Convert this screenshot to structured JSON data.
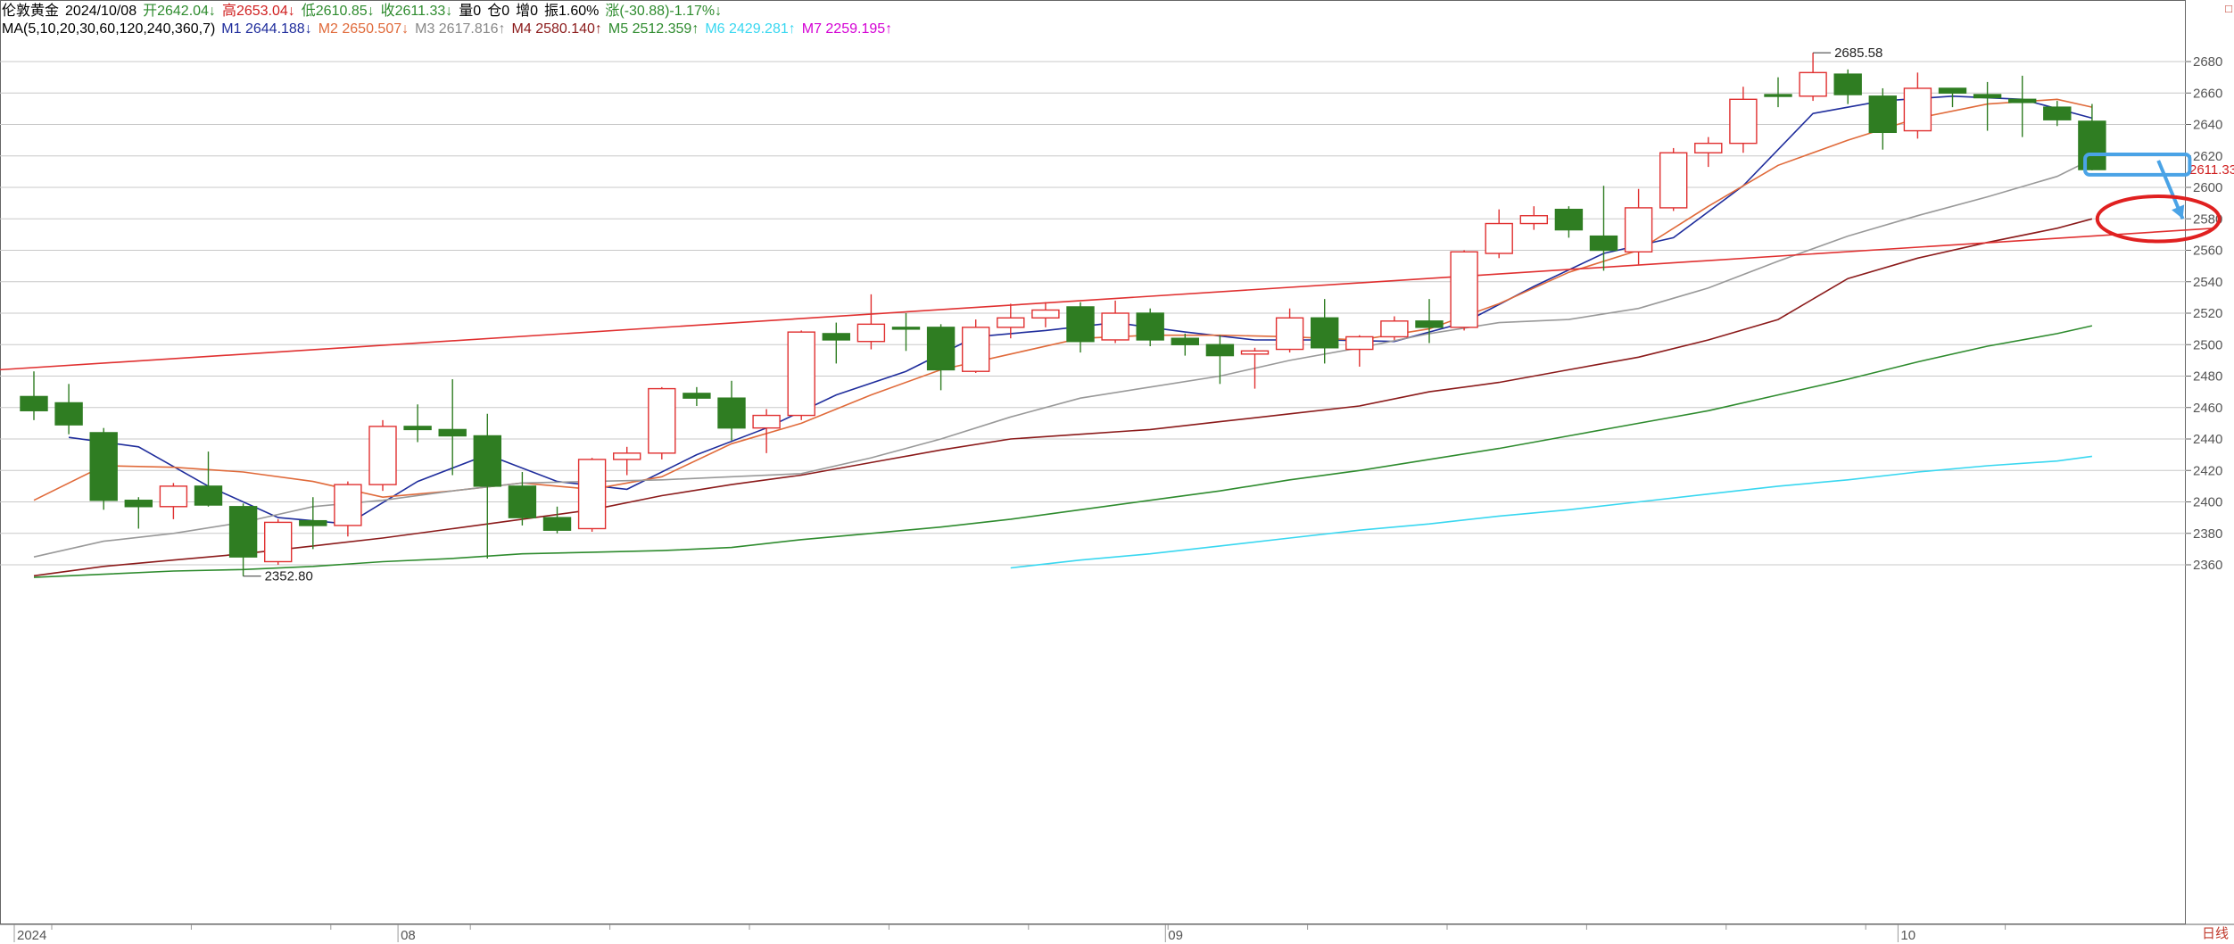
{
  "header": {
    "instrument": "伦敦黄金",
    "date": "2024/10/08",
    "open": "开2642.04↓",
    "high": "高2653.04↓",
    "low": "低2610.85↓",
    "close": "收2611.33↓",
    "volume": "量0",
    "position": "仓0",
    "increase": "增0",
    "amplitude": "振1.60%",
    "change": "涨(-30.88)-1.17%↓"
  },
  "ma_header": {
    "params": "MA(5,10,20,30,60,120,240,360,7)",
    "items": [
      {
        "text": "M1 2644.188↓",
        "color": "#1f2d9c"
      },
      {
        "text": "M2 2650.507↓",
        "color": "#e06a3a"
      },
      {
        "text": "M3 2617.816↑",
        "color": "#888888"
      },
      {
        "text": "M4 2580.140↑",
        "color": "#8b1a1a"
      },
      {
        "text": "M5 2512.359↑",
        "color": "#2e8b2e"
      },
      {
        "text": "M6 2429.281↑",
        "color": "#39d7f0"
      },
      {
        "text": "M7 2259.195↑",
        "color": "#d400d4"
      }
    ]
  },
  "period_label": "日线",
  "corner_mark": "□",
  "chart_data": {
    "type": "candlestick",
    "y_ticks": [
      2360,
      2380,
      2400,
      2420,
      2440,
      2460,
      2480,
      2500,
      2520,
      2540,
      2560,
      2580,
      2600,
      2620,
      2640,
      2660,
      2680
    ],
    "ylim": [
      2350,
      2693
    ],
    "current_price_label": "2611.33",
    "x_labels": [
      {
        "index": 0,
        "text": "2024"
      },
      {
        "index": 11,
        "text": "08"
      },
      {
        "index": 33,
        "text": "09"
      },
      {
        "index": 54,
        "text": "10"
      }
    ],
    "annotations": {
      "max_label": "2685.58",
      "max_index": 51,
      "min_label": "2352.80",
      "min_index": 6
    },
    "candles": [
      {
        "o": 2467,
        "h": 2483,
        "l": 2452,
        "c": 2458
      },
      {
        "o": 2463,
        "h": 2475,
        "l": 2443,
        "c": 2449
      },
      {
        "o": 2444,
        "h": 2447,
        "l": 2395,
        "c": 2401
      },
      {
        "o": 2401,
        "h": 2403,
        "l": 2383,
        "c": 2397
      },
      {
        "o": 2397,
        "h": 2412,
        "l": 2389,
        "c": 2410
      },
      {
        "o": 2410,
        "h": 2432,
        "l": 2397,
        "c": 2398
      },
      {
        "o": 2397,
        "h": 2399,
        "l": 2352.8,
        "c": 2365
      },
      {
        "o": 2362,
        "h": 2389,
        "l": 2360,
        "c": 2387
      },
      {
        "o": 2388,
        "h": 2403,
        "l": 2370,
        "c": 2385
      },
      {
        "o": 2385,
        "h": 2413,
        "l": 2378,
        "c": 2411
      },
      {
        "o": 2411,
        "h": 2452,
        "l": 2407,
        "c": 2448
      },
      {
        "o": 2448,
        "h": 2462,
        "l": 2438,
        "c": 2446
      },
      {
        "o": 2446,
        "h": 2478,
        "l": 2417,
        "c": 2442
      },
      {
        "o": 2442,
        "h": 2456,
        "l": 2364,
        "c": 2410
      },
      {
        "o": 2410,
        "h": 2419,
        "l": 2385,
        "c": 2390
      },
      {
        "o": 2390,
        "h": 2397,
        "l": 2380,
        "c": 2382
      },
      {
        "o": 2383,
        "h": 2428,
        "l": 2381,
        "c": 2427
      },
      {
        "o": 2427,
        "h": 2435,
        "l": 2417,
        "c": 2431
      },
      {
        "o": 2431,
        "h": 2473,
        "l": 2427,
        "c": 2472
      },
      {
        "o": 2469,
        "h": 2473,
        "l": 2461,
        "c": 2466
      },
      {
        "o": 2466,
        "h": 2477,
        "l": 2439,
        "c": 2447
      },
      {
        "o": 2447,
        "h": 2459,
        "l": 2431,
        "c": 2455
      },
      {
        "o": 2455,
        "h": 2509,
        "l": 2452,
        "c": 2508
      },
      {
        "o": 2507,
        "h": 2514,
        "l": 2488,
        "c": 2503
      },
      {
        "o": 2502,
        "h": 2532,
        "l": 2497,
        "c": 2513
      },
      {
        "o": 2511,
        "h": 2520,
        "l": 2496,
        "c": 2510
      },
      {
        "o": 2511,
        "h": 2513,
        "l": 2471,
        "c": 2484
      },
      {
        "o": 2483,
        "h": 2516,
        "l": 2482,
        "c": 2511
      },
      {
        "o": 2511,
        "h": 2526,
        "l": 2504,
        "c": 2517
      },
      {
        "o": 2517,
        "h": 2527,
        "l": 2511,
        "c": 2522
      },
      {
        "o": 2524,
        "h": 2527,
        "l": 2495,
        "c": 2502
      },
      {
        "o": 2503,
        "h": 2528,
        "l": 2501,
        "c": 2520
      },
      {
        "o": 2520,
        "h": 2523,
        "l": 2499,
        "c": 2503
      },
      {
        "o": 2504,
        "h": 2507,
        "l": 2493,
        "c": 2500
      },
      {
        "o": 2500,
        "h": 2506,
        "l": 2475,
        "c": 2493
      },
      {
        "o": 2494,
        "h": 2498,
        "l": 2472,
        "c": 2496
      },
      {
        "o": 2497,
        "h": 2523,
        "l": 2495,
        "c": 2517
      },
      {
        "o": 2517,
        "h": 2529,
        "l": 2488,
        "c": 2498
      },
      {
        "o": 2497,
        "h": 2506,
        "l": 2486,
        "c": 2505
      },
      {
        "o": 2505,
        "h": 2518,
        "l": 2503,
        "c": 2515
      },
      {
        "o": 2515,
        "h": 2529,
        "l": 2501,
        "c": 2511
      },
      {
        "o": 2511,
        "h": 2560,
        "l": 2509,
        "c": 2559
      },
      {
        "o": 2558,
        "h": 2586,
        "l": 2555,
        "c": 2577
      },
      {
        "o": 2577,
        "h": 2588,
        "l": 2573,
        "c": 2582
      },
      {
        "o": 2586,
        "h": 2588,
        "l": 2568,
        "c": 2573
      },
      {
        "o": 2569,
        "h": 2601,
        "l": 2547,
        "c": 2560
      },
      {
        "o": 2559,
        "h": 2599,
        "l": 2551,
        "c": 2587
      },
      {
        "o": 2587,
        "h": 2625,
        "l": 2585,
        "c": 2622
      },
      {
        "o": 2622,
        "h": 2632,
        "l": 2613,
        "c": 2628
      },
      {
        "o": 2628,
        "h": 2664,
        "l": 2622,
        "c": 2656
      },
      {
        "o": 2659,
        "h": 2670,
        "l": 2651,
        "c": 2658
      },
      {
        "o": 2658,
        "h": 2685.58,
        "l": 2655,
        "c": 2673
      },
      {
        "o": 2672,
        "h": 2675,
        "l": 2653,
        "c": 2659
      },
      {
        "o": 2658,
        "h": 2663,
        "l": 2624,
        "c": 2635
      },
      {
        "o": 2636,
        "h": 2673,
        "l": 2631,
        "c": 2663
      },
      {
        "o": 2663,
        "h": 2663,
        "l": 2651,
        "c": 2660
      },
      {
        "o": 2659,
        "h": 2667,
        "l": 2636,
        "c": 2657
      },
      {
        "o": 2656,
        "h": 2671,
        "l": 2632,
        "c": 2654
      },
      {
        "o": 2651,
        "h": 2655,
        "l": 2639,
        "c": 2643
      },
      {
        "o": 2642.04,
        "h": 2653.04,
        "l": 2610.85,
        "c": 2611.33
      }
    ],
    "ma_lines": [
      {
        "name": "M1",
        "color": "#1f2d9c",
        "values": [
          [
            1,
            2441
          ],
          [
            3,
            2435
          ],
          [
            5,
            2410
          ],
          [
            7,
            2390
          ],
          [
            9,
            2386
          ],
          [
            11,
            2413
          ],
          [
            13,
            2430
          ],
          [
            15,
            2413
          ],
          [
            17,
            2408
          ],
          [
            19,
            2430
          ],
          [
            21,
            2447
          ],
          [
            23,
            2468
          ],
          [
            25,
            2483
          ],
          [
            27,
            2505
          ],
          [
            29,
            2509
          ],
          [
            31,
            2514
          ],
          [
            33,
            2508
          ],
          [
            35,
            2503
          ],
          [
            37,
            2503
          ],
          [
            39,
            2502
          ],
          [
            41,
            2514
          ],
          [
            43,
            2537
          ],
          [
            45,
            2558
          ],
          [
            47,
            2568
          ],
          [
            49,
            2601
          ],
          [
            51,
            2647
          ],
          [
            53,
            2655
          ],
          [
            55,
            2658
          ],
          [
            57,
            2656
          ],
          [
            59,
            2644
          ]
        ]
      },
      {
        "name": "M2",
        "color": "#e06a3a",
        "values": [
          [
            0,
            2401
          ],
          [
            2,
            2423
          ],
          [
            4,
            2422
          ],
          [
            6,
            2419
          ],
          [
            8,
            2413
          ],
          [
            10,
            2403
          ],
          [
            12,
            2407
          ],
          [
            14,
            2412
          ],
          [
            16,
            2408
          ],
          [
            18,
            2416
          ],
          [
            20,
            2437
          ],
          [
            22,
            2450
          ],
          [
            24,
            2468
          ],
          [
            26,
            2484
          ],
          [
            28,
            2494
          ],
          [
            30,
            2504
          ],
          [
            32,
            2506
          ],
          [
            34,
            2506
          ],
          [
            36,
            2505
          ],
          [
            38,
            2503
          ],
          [
            40,
            2510
          ],
          [
            42,
            2526
          ],
          [
            44,
            2546
          ],
          [
            46,
            2560
          ],
          [
            48,
            2588
          ],
          [
            50,
            2614
          ],
          [
            52,
            2630
          ],
          [
            54,
            2644
          ],
          [
            56,
            2653
          ],
          [
            58,
            2656
          ],
          [
            59,
            2651
          ]
        ]
      },
      {
        "name": "M3",
        "color": "#999999",
        "values": [
          [
            0,
            2365
          ],
          [
            2,
            2375
          ],
          [
            4,
            2380
          ],
          [
            6,
            2387
          ],
          [
            8,
            2397
          ],
          [
            10,
            2401
          ],
          [
            12,
            2407
          ],
          [
            14,
            2412
          ],
          [
            16,
            2413
          ],
          [
            18,
            2414
          ],
          [
            20,
            2416
          ],
          [
            22,
            2418
          ],
          [
            24,
            2428
          ],
          [
            26,
            2440
          ],
          [
            28,
            2454
          ],
          [
            30,
            2466
          ],
          [
            32,
            2473
          ],
          [
            34,
            2480
          ],
          [
            36,
            2490
          ],
          [
            38,
            2498
          ],
          [
            40,
            2507
          ],
          [
            42,
            2514
          ],
          [
            44,
            2516
          ],
          [
            46,
            2523
          ],
          [
            48,
            2536
          ],
          [
            50,
            2553
          ],
          [
            52,
            2569
          ],
          [
            54,
            2582
          ],
          [
            56,
            2594
          ],
          [
            58,
            2607
          ],
          [
            59,
            2618
          ]
        ]
      },
      {
        "name": "M4",
        "color": "#8b1a1a",
        "values": [
          [
            0,
            2353
          ],
          [
            2,
            2359
          ],
          [
            4,
            2363
          ],
          [
            6,
            2367
          ],
          [
            8,
            2372
          ],
          [
            10,
            2377
          ],
          [
            12,
            2383
          ],
          [
            14,
            2389
          ],
          [
            16,
            2395
          ],
          [
            18,
            2404
          ],
          [
            20,
            2411
          ],
          [
            22,
            2417
          ],
          [
            24,
            2425
          ],
          [
            26,
            2433
          ],
          [
            28,
            2440
          ],
          [
            30,
            2443
          ],
          [
            32,
            2446
          ],
          [
            34,
            2451
          ],
          [
            36,
            2456
          ],
          [
            38,
            2461
          ],
          [
            40,
            2470
          ],
          [
            42,
            2476
          ],
          [
            44,
            2484
          ],
          [
            46,
            2492
          ],
          [
            48,
            2503
          ],
          [
            50,
            2516
          ],
          [
            52,
            2542
          ],
          [
            54,
            2555
          ],
          [
            56,
            2565
          ],
          [
            58,
            2574
          ],
          [
            59,
            2580
          ]
        ]
      },
      {
        "name": "M5",
        "color": "#2e8b2e",
        "values": [
          [
            0,
            2352
          ],
          [
            2,
            2354
          ],
          [
            4,
            2356
          ],
          [
            6,
            2357
          ],
          [
            8,
            2359
          ],
          [
            10,
            2362
          ],
          [
            12,
            2364
          ],
          [
            14,
            2367
          ],
          [
            16,
            2368
          ],
          [
            18,
            2369
          ],
          [
            20,
            2371
          ],
          [
            22,
            2376
          ],
          [
            24,
            2380
          ],
          [
            26,
            2384
          ],
          [
            28,
            2389
          ],
          [
            30,
            2395
          ],
          [
            32,
            2401
          ],
          [
            34,
            2407
          ],
          [
            36,
            2414
          ],
          [
            38,
            2420
          ],
          [
            40,
            2427
          ],
          [
            42,
            2434
          ],
          [
            44,
            2442
          ],
          [
            46,
            2450
          ],
          [
            48,
            2458
          ],
          [
            50,
            2468
          ],
          [
            52,
            2478
          ],
          [
            54,
            2489
          ],
          [
            56,
            2499
          ],
          [
            58,
            2507
          ],
          [
            59,
            2512
          ]
        ]
      },
      {
        "name": "M6",
        "color": "#39d7f0",
        "values": [
          [
            28,
            2358
          ],
          [
            30,
            2363
          ],
          [
            32,
            2367
          ],
          [
            34,
            2372
          ],
          [
            36,
            2377
          ],
          [
            38,
            2382
          ],
          [
            40,
            2386
          ],
          [
            42,
            2391
          ],
          [
            44,
            2395
          ],
          [
            46,
            2400
          ],
          [
            48,
            2405
          ],
          [
            50,
            2410
          ],
          [
            52,
            2414
          ],
          [
            54,
            2419
          ],
          [
            56,
            2423
          ],
          [
            58,
            2426
          ],
          [
            59,
            2429
          ]
        ]
      }
    ],
    "trendline": {
      "color": "#e03030",
      "from": [
        -1,
        2484
      ],
      "to": [
        62.5,
        2574
      ]
    },
    "markup": {
      "box": {
        "from": [
          58.8,
          2621
        ],
        "to": [
          61.8,
          2608
        ],
        "color": "#4aa3e6"
      },
      "arrow": {
        "from": [
          60.9,
          2617
        ],
        "to": [
          61.6,
          2580
        ],
        "color": "#4aa3e6"
      },
      "ellipse": {
        "center": [
          60.9,
          2580
        ],
        "rx": 1.75,
        "ry": 6.5,
        "color": "#e02020"
      }
    }
  }
}
